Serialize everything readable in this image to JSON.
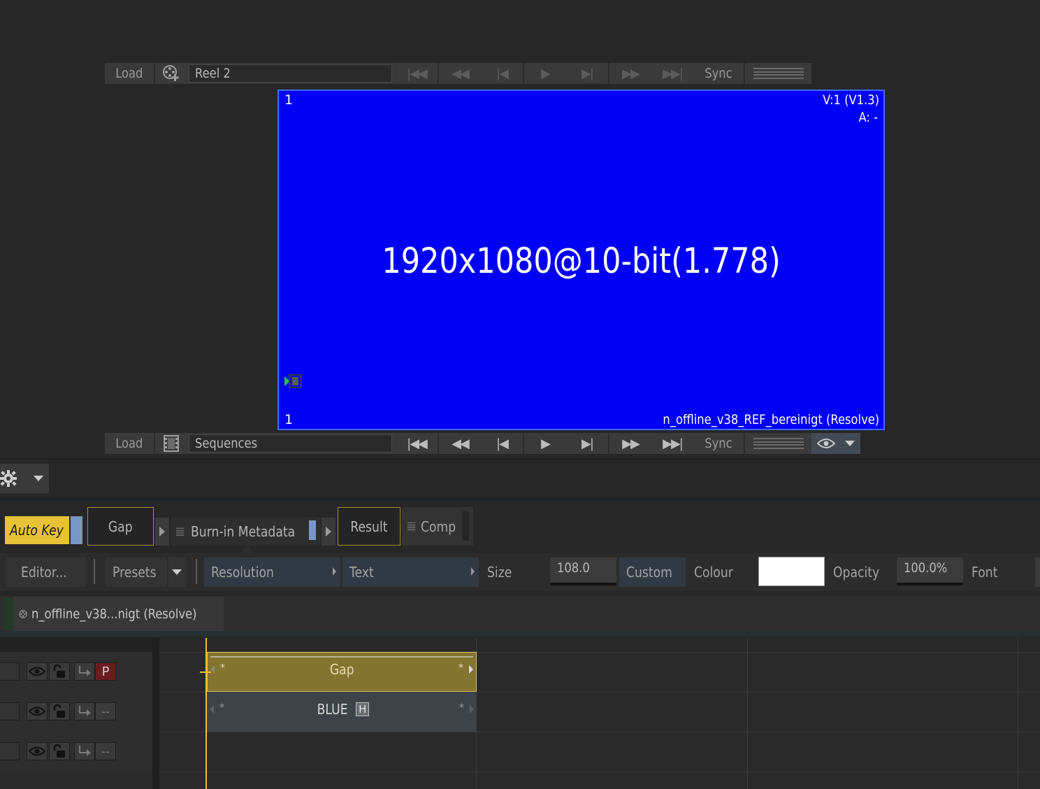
{
  "top_transport": {
    "load_label": "Load",
    "reel_icon": "reel-add-icon",
    "source_field": "Reel 2",
    "sync_label": "Sync"
  },
  "viewer": {
    "frame_top_left": "1",
    "frame_bottom_left": "1",
    "version_label": "V:1 (V1.3)",
    "audio_label": "A: -",
    "center_text": "1920x1080@10-bit(1.778)",
    "clip_name": "n_offline_v38_REF_bereinigt (Resolve)",
    "background_color": "#0000f5"
  },
  "bottom_transport": {
    "load_label": "Load",
    "source_field": "Sequences",
    "sync_label": "Sync",
    "eye_icon": "eye-icon"
  },
  "node_bar": {
    "auto_key_label": "Auto Key",
    "gap_label": "Gap",
    "burnin_label": "Burn-in Metadata",
    "result_label": "Result",
    "comp_label": "Comp"
  },
  "params": {
    "editor_label": "Editor...",
    "presets_label": "Presets",
    "resolution_label": "Resolution",
    "text_label": "Text",
    "size_label": "Size",
    "size_value": "108.0",
    "custom_label": "Custom",
    "colour_label": "Colour",
    "colour_value": "#ffffff",
    "opacity_label": "Opacity",
    "opacity_value": "100.0%",
    "font_label": "Font"
  },
  "sequence_tab": {
    "label": "n_offline_v38...nigt (Resolve)"
  },
  "tracks": [
    {
      "priority": "P",
      "clip": "Gap",
      "clip_color": "#857430"
    },
    {
      "priority": "--",
      "clip": "BLUE",
      "clip_badge": "H",
      "clip_color": "#3e434a"
    },
    {
      "priority": "--"
    }
  ]
}
